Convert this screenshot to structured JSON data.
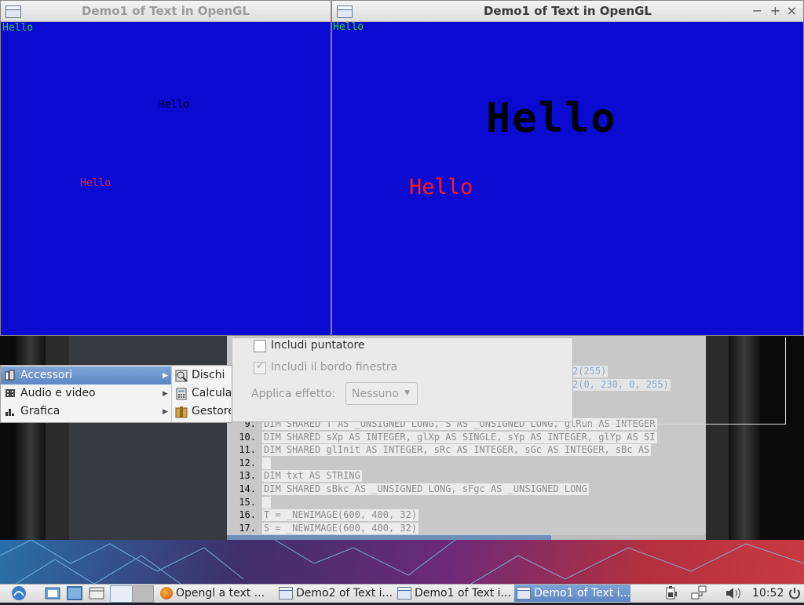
{
  "windows": [
    {
      "title": "Demo1 of Text in OpenGL",
      "title_active": false,
      "texts": [
        {
          "text": "Hello",
          "color": "#22dd22"
        },
        {
          "text": "Hello",
          "color": "#000000"
        },
        {
          "text": "Hello",
          "color": "#ff1a1a"
        }
      ]
    },
    {
      "title": "Demo1 of Text in OpenGL",
      "title_active": true,
      "controls": [
        "−",
        "+",
        "×"
      ],
      "texts": [
        {
          "text": "Hello",
          "color": "#22dd22"
        },
        {
          "text": "Hello",
          "color": "#000000"
        },
        {
          "text": "Hello",
          "color": "#ff1a1a"
        }
      ]
    }
  ],
  "dialog": {
    "include_pointer_label": "Includi puntatore",
    "include_pointer_checked": false,
    "include_border_label": "Includi il bordo finestra",
    "include_border_checked": true,
    "effect_label": "Applica effetto:",
    "effect_value": "Nessuno"
  },
  "menu": {
    "items": [
      "Accessori",
      "Audio e video",
      "Grafica"
    ],
    "submenu": [
      "Dischi",
      "Calcula",
      "Gestore"
    ]
  },
  "editor": {
    "partial_lines": [
      "2(255)",
      "2(0, 230, 0, 255)"
    ],
    "lines": [
      {
        "n": "9.",
        "code": "DIM SHARED T AS _UNSIGNED LONG, S AS _UNSIGNED LONG, glRun AS INTEGER"
      },
      {
        "n": "10.",
        "code": "DIM SHARED sXp AS INTEGER, glXp AS SINGLE, sYp AS INTEGER, glYp AS SI"
      },
      {
        "n": "11.",
        "code": "DIM SHARED glInit AS INTEGER, sRc AS INTEGER, sGc AS INTEGER, sBc AS"
      },
      {
        "n": "12.",
        "code": " "
      },
      {
        "n": "13.",
        "code": "DIM txt AS STRING"
      },
      {
        "n": "14.",
        "code": "DIM SHARED sBkc AS _UNSIGNED LONG, sFgc AS _UNSIGNED LONG"
      },
      {
        "n": "15.",
        "code": " "
      },
      {
        "n": "16.",
        "code": "T = _NEWIMAGE(600, 400, 32)"
      },
      {
        "n": "17.",
        "code": "S = _NEWIMAGE(600, 400, 32)"
      }
    ]
  },
  "taskbar": {
    "tasks": [
      "Opengl a text ...",
      "Demo2 of Text i...",
      "Demo1 of Text i...",
      "Demo1 of Text i..."
    ],
    "clock": "10:52"
  },
  "colors": {
    "gl_background": "#0a0ad0",
    "menu_highlight": "#6b93cc"
  }
}
